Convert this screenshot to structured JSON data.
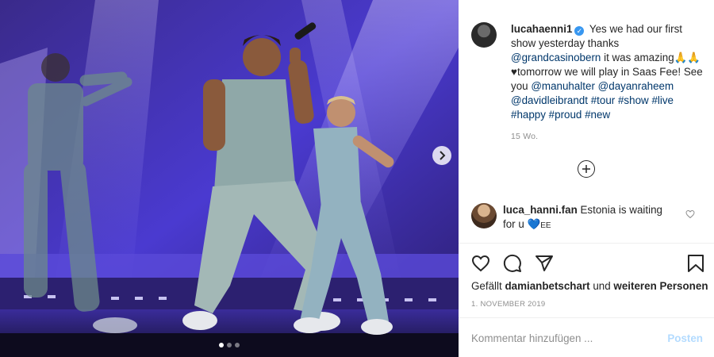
{
  "photo": {
    "alt": "Concert performance photo",
    "next_icon": "chevron-right-icon",
    "carousel_dots": 3,
    "active_dot": 0
  },
  "post": {
    "username": "lucahaenni1",
    "verified": true,
    "caption_line_1": "Yes we had our first show yesterday thanks",
    "mention_1": "@grandcasinobern",
    "caption_line_2": "it was amazing",
    "emoji_1": "🙏🙏",
    "caption_line_3": "♥tomorrow we will play in Saas Fee! See you",
    "mention_2": "@manuhalter",
    "mention_3": "@dayanraheem",
    "mention_4": "@davidleibrandt",
    "tags": [
      "#tour",
      "#show",
      "#live",
      "#happy",
      "#proud",
      "#new"
    ],
    "age": "15 Wo."
  },
  "comment": {
    "username": "luca_hanni.fan",
    "text": "Estonia is waiting for u",
    "emoji": "💙",
    "suffix": "EE"
  },
  "likes": {
    "prefix": "Gefällt",
    "user": "damianbetschart",
    "middle": "und",
    "rest": "weiteren Personen"
  },
  "date": "1. NOVEMBER 2019",
  "composer": {
    "placeholder": "Kommentar hinzufügen ...",
    "post_label": "Posten"
  },
  "colors": {
    "link": "#00376b",
    "verified": "#3897f0",
    "post_disabled": "#b3dbff",
    "muted": "#8e8e8e"
  }
}
